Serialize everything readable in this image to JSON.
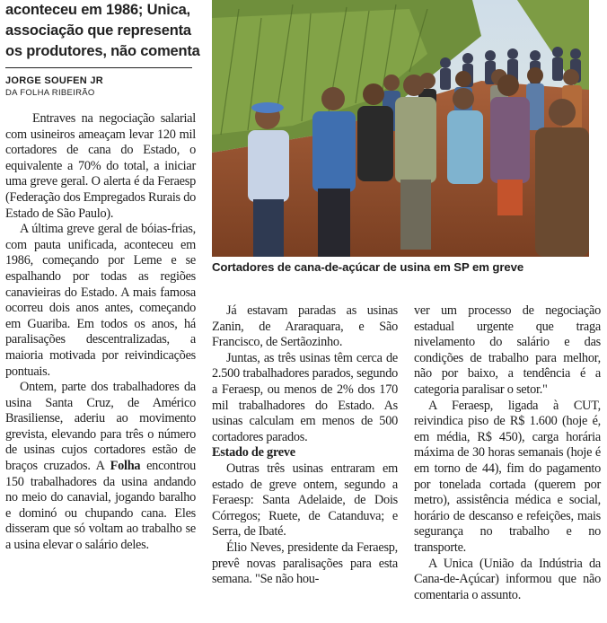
{
  "deck_lines": [
    "aconteceu em 1986; Unica,",
    "associação que representa",
    "os produtores, não comenta"
  ],
  "byline": {
    "author": "JORGE SOUFEN JR",
    "outlet": "DA FOLHA RIBEIRÃO"
  },
  "photo_caption": "Cortadores de cana-de-açúcar de usina em SP em greve",
  "col1": {
    "p1": "Entraves na negociação salarial com usineiros ameaçam levar 120 mil cortadores de cana do Estado, o equivalente a 70% do total, a iniciar uma greve geral. O alerta é da Feraesp (Federação dos Empregados Rurais do Estado de São Paulo).",
    "p2": "A última greve geral de bóias-frias, com pauta unificada, aconteceu em 1986, começando por Leme e se espalhando por todas as regiões canavieiras do Estado. A mais famosa ocorreu dois anos antes, começando em Guariba. Em todos os anos, há paralisações descentralizadas, a maioria motivada por reivindicações pontuais.",
    "p3_before": "Ontem, parte dos trabalhadores da usina Santa Cruz, de Américo Brasiliense, aderiu ao movimento grevista, elevando para três o número de usinas cujos cortadores estão de braços cruzados. A ",
    "p3_bold": "Folha",
    "p3_after": " encontrou 150 trabalhadores da usina andando no meio do canavial, jogando baralho e dominó ou chupando cana. Eles disseram que só voltam ao trabalho se a usina elevar o salário deles."
  },
  "col2": {
    "p1": "Já estavam paradas as usinas Zanin, de Araraquara, e São Francisco, de Sertãozinho.",
    "p2": "Juntas, as três usinas têm cerca de 2.500 trabalhadores parados, segundo a Feraesp, ou menos de 2% dos 170 mil trabalhadores do Estado. As usinas calculam em menos de 500 cortadores parados.",
    "subhead": "Estado de greve",
    "p3": "Outras três usinas entraram em estado de greve ontem, segundo a Feraesp: Santa Adelaide, de Dois Córregos; Ruete, de Catanduva; e Serra, de Ibaté.",
    "p4": "Élio Neves, presidente da Feraesp, prevê novas paralisações para esta semana. \"Se não hou-"
  },
  "col3": {
    "p1": "ver um processo de negociação estadual urgente que traga nivelamento do salário e das condições de trabalho para melhor, não por baixo, a tendência é a categoria paralisar o setor.\"",
    "p2": "A Feraesp, ligada à CUT, reivindica piso de R$ 1.600 (hoje é, em média, R$ 450), carga horária máxima de 30 horas semanais (hoje é em torno de 44), fim do pagamento por tonelada cortada (querem por metro), assistência médica e social, horário de descanso e refeições, mais segurança no trabalho e no transporte.",
    "p3": "A Unica (União da Indústria da Cana-de-Açúcar) informou que não comentaria o assunto."
  }
}
